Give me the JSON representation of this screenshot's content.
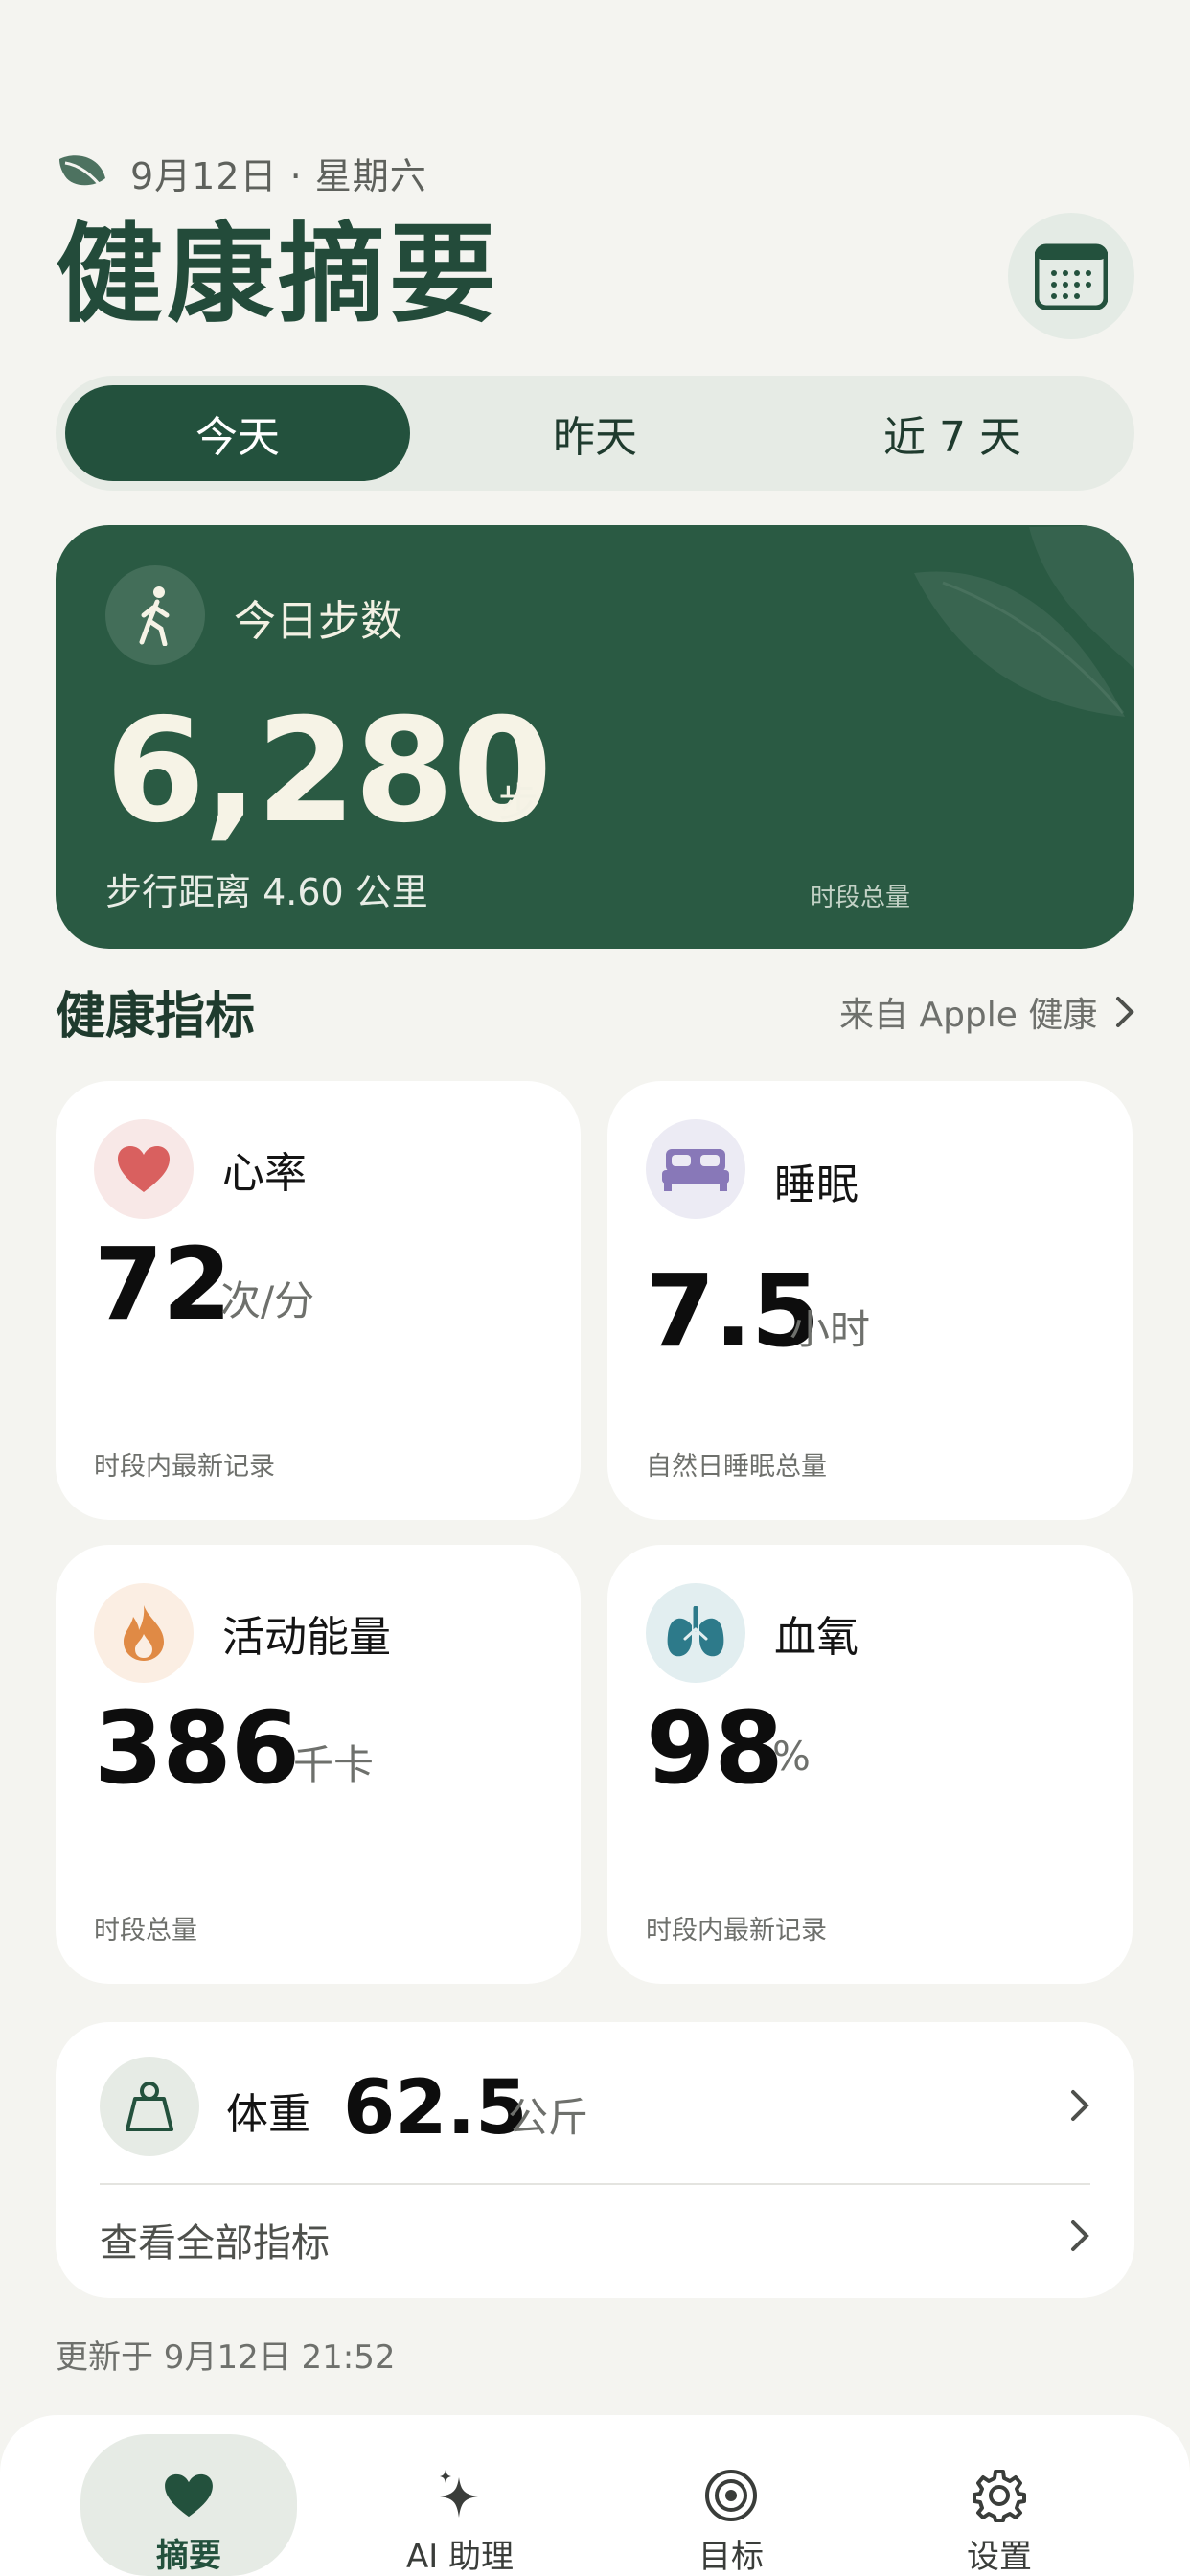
{
  "header": {
    "date": "9月12日 · 星期六",
    "title": "健康摘要"
  },
  "tabs": [
    {
      "label": "今天",
      "active": true
    },
    {
      "label": "昨天",
      "active": false
    },
    {
      "label": "近 7 天",
      "active": false
    }
  ],
  "steps": {
    "label": "今日步数",
    "value": "6,280",
    "unit": "步",
    "distance": "步行距离 4.60 公里",
    "period_note": "时段总量"
  },
  "metrics_section": {
    "title": "健康指标",
    "source_link": "来自 Apple 健康"
  },
  "metrics": {
    "heart_rate": {
      "label": "心率",
      "value": "72",
      "unit": "次/分",
      "footnote": "时段内最新记录",
      "icon": "heart-icon",
      "color": "#d9605f"
    },
    "sleep": {
      "label": "睡眠",
      "value": "7.5",
      "unit": "小时",
      "footnote": "自然日睡眠总量",
      "icon": "bed-icon",
      "color": "#8878b8"
    },
    "energy": {
      "label": "活动能量",
      "value": "386",
      "unit": "千卡",
      "footnote": "时段总量",
      "icon": "flame-icon",
      "color": "#e08a45"
    },
    "oxygen": {
      "label": "血氧",
      "value": "98",
      "unit": "%",
      "footnote": "时段内最新记录",
      "icon": "lungs-icon",
      "color": "#2d7a8a"
    }
  },
  "weight": {
    "label": "体重",
    "value": "62.5",
    "unit": "公斤",
    "view_all": "查看全部指标"
  },
  "updated": "更新于 9月12日 21:52",
  "nav": [
    {
      "label": "摘要",
      "icon": "heart-icon",
      "active": true
    },
    {
      "label": "AI 助理",
      "icon": "sparkle-icon",
      "active": false
    },
    {
      "label": "目标",
      "icon": "target-icon",
      "active": false
    },
    {
      "label": "设置",
      "icon": "gear-icon",
      "active": false
    }
  ],
  "colors": {
    "primary": "#23513d",
    "background": "#f4f4f0",
    "card": "#ffffff"
  }
}
